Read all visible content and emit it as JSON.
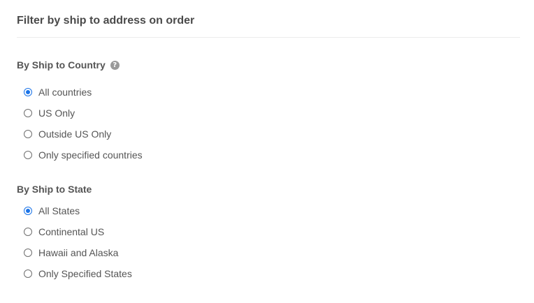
{
  "header": {
    "title": "Filter by ship to address on order"
  },
  "country_group": {
    "label": "By Ship to Country",
    "help_icon": "question-circle-icon",
    "options": [
      {
        "label": "All countries",
        "selected": true
      },
      {
        "label": "US Only",
        "selected": false
      },
      {
        "label": "Outside US Only",
        "selected": false
      },
      {
        "label": "Only specified countries",
        "selected": false
      }
    ]
  },
  "state_group": {
    "label": "By Ship to State",
    "options": [
      {
        "label": "All States",
        "selected": true
      },
      {
        "label": "Continental US",
        "selected": false
      },
      {
        "label": "Hawaii and Alaska",
        "selected": false
      },
      {
        "label": "Only Specified States",
        "selected": false
      }
    ]
  },
  "colors": {
    "accent": "#1a73e8",
    "text": "#555555",
    "divider": "#ececec"
  }
}
